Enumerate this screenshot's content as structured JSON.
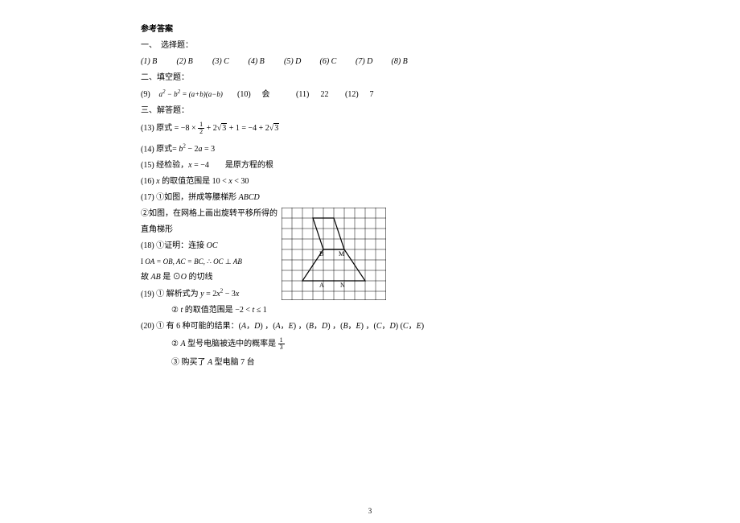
{
  "title": "参考答案",
  "sec1": {
    "heading": "一、　选择题："
  },
  "mc": {
    "a1": "(1) B",
    "a2": "(2) B",
    "a3": "(3) C",
    "a4": "(4) B",
    "a5": "(5) D",
    "a6": "(6) C",
    "a7": "(7) D",
    "a8": "(8) B"
  },
  "sec2": {
    "heading": "二、填空题："
  },
  "fib": {
    "q9_label": "(9)",
    "q9_expr": "a² − b² = (a+b)(a−b)",
    "q10_label": "(10)",
    "q10_ans": "会",
    "q11_label": "(11)",
    "q11_ans": "22",
    "q12_label": "(12)",
    "q12_ans": "7"
  },
  "sec3": {
    "heading": "三、解答题："
  },
  "q13": {
    "label": "(13)",
    "prefix": "原式",
    "eq1": "= −8 ×",
    "frac_num": "1",
    "frac_den": "2",
    "mid": "+ 2",
    "rad1": "3",
    "mid2": "+ 1 = −4 + 2",
    "rad2": "3"
  },
  "q14": {
    "label": "(14)",
    "text": "原式= b² − 2a = 3"
  },
  "q15": {
    "label": "(15)",
    "text": "经检验，x = −4　　是原方程的根"
  },
  "q16": {
    "label": "(16)",
    "text": "x 的取值范围是 10 < x < 30"
  },
  "q17": {
    "label": "(17)",
    "p1": "①如图，拼成等腰梯形 ABCD",
    "p2": "②如图，在网格上画出旋转平移所得的",
    "p3": "直角梯形"
  },
  "q18": {
    "label": "(18)",
    "p1": "①证明：连接  OC",
    "p2_pre": "I ",
    "p2": "OA = OB, AC = BC, ∴ OC ⊥ AB",
    "p3": "故 AB 是 ⊙O 的切线"
  },
  "q19": {
    "label": "(19)",
    "p1": "① 解析式为 y = 2x² − 3x",
    "p2": "② t 的取值范围是 −2 < t ≤ 1"
  },
  "q20": {
    "label": "(20)",
    "p1": "① 有 6 种可能的结果：(A，D) ，(A，E) ，(B，D) ，(B，E) ，(C，D) (C，E)",
    "p2_pre": "② A 型号电脑被选中的概率是",
    "p2_num": "1",
    "p2_den": "3",
    "p3": "③ 购买了 A 型电脑 7 台"
  },
  "grid": {
    "B": "B",
    "M": "M",
    "A": "A",
    "N": "N"
  },
  "page_number": "3"
}
